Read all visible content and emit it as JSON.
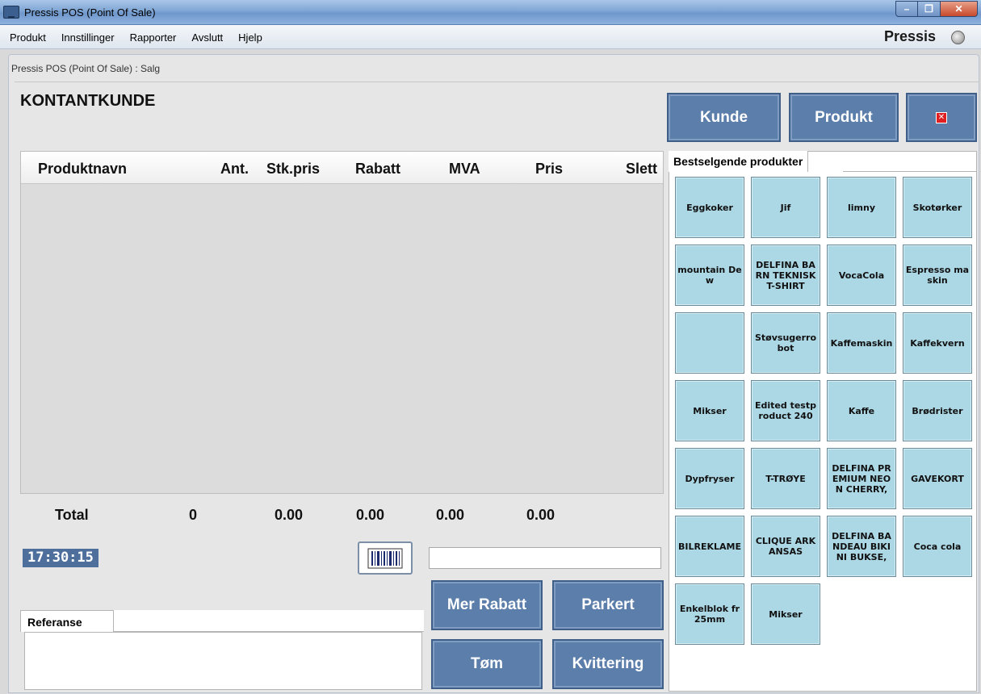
{
  "window": {
    "title": "Pressis POS (Point Of Sale)"
  },
  "menu": {
    "items": [
      "Produkt",
      "Innstillinger",
      "Rapporter",
      "Avslutt",
      "Hjelp"
    ],
    "brand": "Pressis"
  },
  "breadcrumb": "Pressis POS (Point Of Sale) : Salg",
  "customer": "KONTANTKUNDE",
  "top_buttons": {
    "kunde": "Kunde",
    "produkt": "Produkt"
  },
  "grid": {
    "columns": [
      "Produktnavn",
      "Ant.",
      "Stk.pris",
      "Rabatt",
      "MVA",
      "Pris",
      "Slett"
    ]
  },
  "totals": {
    "label": "Total",
    "ant": "0",
    "stk": "0.00",
    "rabatt": "0.00",
    "mva": "0.00",
    "pris": "0.00"
  },
  "clock": "17:30:15",
  "actions": {
    "mer_rabatt": "Mer Rabatt",
    "parkert": "Parkert",
    "tom": "Tøm",
    "kvittering": "Kvittering"
  },
  "reference": {
    "tab": "Referanse"
  },
  "bestsellers": {
    "tab": "Bestselgende produkter",
    "tiles": [
      "Eggkoker",
      "Jif",
      "limny",
      "Skotørker",
      "mountain Dew",
      "DELFINA BARN TEKNISK T-SHIRT",
      "VocaCola",
      "Espresso maskin",
      "",
      "Støvsugerrobot",
      "Kaffemaskin",
      "Kaffekvern",
      "Mikser",
      "Edited testproduct 240",
      "Kaffe",
      "Brødrister",
      "Dypfryser",
      "T-TRØYE",
      "DELFINA PREMIUM NEON CHERRY,",
      "GAVEKORT",
      "BILREKLAME",
      "CLIQUE ARKANSAS",
      "DELFINA BANDEAU BIKINI BUKSE,",
      "Coca cola",
      "Enkelblok fr 25mm",
      "Mikser"
    ]
  },
  "colors": {
    "button": "#5c7eaa",
    "tile": "#acd8e6",
    "clock_bg": "#4e6f9c"
  }
}
